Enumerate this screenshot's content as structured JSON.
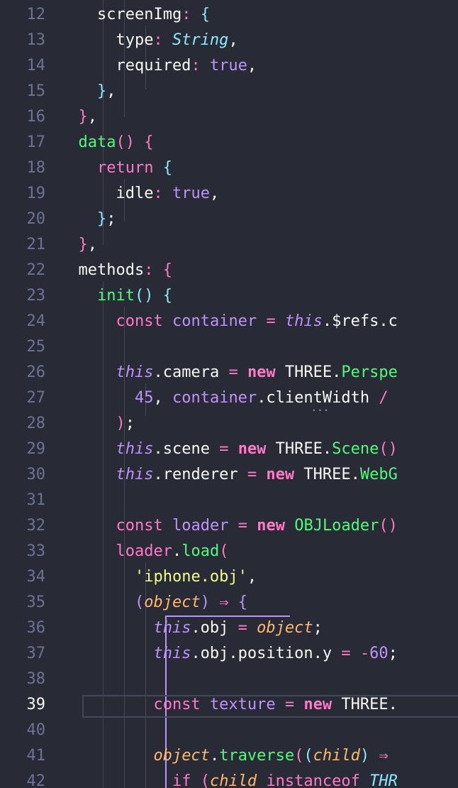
{
  "editor": {
    "theme_colors": {
      "background": "#282a36",
      "foreground": "#f8f8f2",
      "keyword": "#ff79c6",
      "function": "#50fa7b",
      "class": "#8be9fd",
      "string": "#f1fa8c",
      "number": "#bd93f9",
      "parameter": "#ffb86c",
      "gutter": "#6c7393"
    },
    "active_line": "39",
    "lines": [
      {
        "n": "12",
        "tokens": [
          [
            "t-n",
            "    screenImg"
          ],
          [
            "t-o",
            ":"
          ],
          [
            "t-n",
            " "
          ],
          [
            "t-pb",
            "{"
          ]
        ]
      },
      {
        "n": "13",
        "tokens": [
          [
            "t-n",
            "      type"
          ],
          [
            "t-o",
            ":"
          ],
          [
            "t-n",
            " "
          ],
          [
            "t-c",
            "String"
          ],
          [
            "t-n",
            ","
          ]
        ]
      },
      {
        "n": "14",
        "tokens": [
          [
            "t-n",
            "      required"
          ],
          [
            "t-o",
            ":"
          ],
          [
            "t-n",
            " "
          ],
          [
            "t-v",
            "true"
          ],
          [
            "t-n",
            ","
          ]
        ]
      },
      {
        "n": "15",
        "tokens": [
          [
            "t-n",
            "    "
          ],
          [
            "t-pb",
            "}"
          ],
          [
            "t-n",
            ","
          ]
        ]
      },
      {
        "n": "16",
        "tokens": [
          [
            "t-n",
            "  "
          ],
          [
            "t-pk",
            "}"
          ],
          [
            "t-n",
            ","
          ]
        ]
      },
      {
        "n": "17",
        "tokens": [
          [
            "t-n",
            "  "
          ],
          [
            "t-f",
            "data"
          ],
          [
            "t-pk",
            "()"
          ],
          [
            "t-n",
            " "
          ],
          [
            "t-pk",
            "{"
          ]
        ]
      },
      {
        "n": "18",
        "tokens": [
          [
            "t-n",
            "    "
          ],
          [
            "t-k",
            "return"
          ],
          [
            "t-n",
            " "
          ],
          [
            "t-pb",
            "{"
          ]
        ]
      },
      {
        "n": "19",
        "tokens": [
          [
            "t-n",
            "      idle"
          ],
          [
            "t-o",
            ":"
          ],
          [
            "t-n",
            " "
          ],
          [
            "t-v",
            "true"
          ],
          [
            "t-n",
            ","
          ]
        ]
      },
      {
        "n": "20",
        "tokens": [
          [
            "t-n",
            "    "
          ],
          [
            "t-pb",
            "}"
          ],
          [
            "t-n",
            ";"
          ]
        ]
      },
      {
        "n": "21",
        "tokens": [
          [
            "t-n",
            "  "
          ],
          [
            "t-pk",
            "}"
          ],
          [
            "t-n",
            ","
          ]
        ]
      },
      {
        "n": "22",
        "tokens": [
          [
            "t-n",
            "  methods"
          ],
          [
            "t-o",
            ":"
          ],
          [
            "t-n",
            " "
          ],
          [
            "t-pk",
            "{"
          ]
        ]
      },
      {
        "n": "23",
        "tokens": [
          [
            "t-n",
            "    "
          ],
          [
            "t-f",
            "init"
          ],
          [
            "t-pb",
            "()"
          ],
          [
            "t-n",
            " "
          ],
          [
            "t-pb",
            "{"
          ]
        ]
      },
      {
        "n": "24",
        "tokens": [
          [
            "t-n",
            "      "
          ],
          [
            "t-k",
            "const"
          ],
          [
            "t-n",
            " "
          ],
          [
            "t-v",
            "container"
          ],
          [
            "t-n",
            " "
          ],
          [
            "t-o",
            "="
          ],
          [
            "t-n",
            " "
          ],
          [
            "t-i",
            "this"
          ],
          [
            "t-n",
            ".$refs.c"
          ]
        ]
      },
      {
        "n": "25",
        "tokens": []
      },
      {
        "n": "26",
        "tokens": [
          [
            "t-n",
            "      "
          ],
          [
            "t-i",
            "this"
          ],
          [
            "t-n",
            ".camera "
          ],
          [
            "t-o",
            "="
          ],
          [
            "t-n",
            " "
          ],
          [
            "t-kb",
            "new"
          ],
          [
            "t-n",
            " THREE."
          ],
          [
            "t-f",
            "Perspe"
          ]
        ]
      },
      {
        "n": "27",
        "tokens": [
          [
            "t-n",
            "        "
          ],
          [
            "t-num",
            "45"
          ],
          [
            "t-n",
            ", "
          ],
          [
            "t-v",
            "container"
          ],
          [
            "t-n",
            ".clientWidth "
          ],
          [
            "t-o",
            "/"
          ]
        ]
      },
      {
        "n": "28",
        "tokens": [
          [
            "t-n",
            "      "
          ],
          [
            "t-pk",
            ")"
          ],
          [
            "t-n",
            ";"
          ]
        ]
      },
      {
        "n": "29",
        "tokens": [
          [
            "t-n",
            "      "
          ],
          [
            "t-i",
            "this"
          ],
          [
            "t-n",
            ".scene "
          ],
          [
            "t-o",
            "="
          ],
          [
            "t-n",
            " "
          ],
          [
            "t-kb",
            "new"
          ],
          [
            "t-n",
            " THREE."
          ],
          [
            "t-f",
            "Scene"
          ],
          [
            "t-pk",
            "()"
          ]
        ]
      },
      {
        "n": "30",
        "tokens": [
          [
            "t-n",
            "      "
          ],
          [
            "t-i",
            "this"
          ],
          [
            "t-n",
            ".renderer "
          ],
          [
            "t-o",
            "="
          ],
          [
            "t-n",
            " "
          ],
          [
            "t-kb",
            "new"
          ],
          [
            "t-n",
            " THREE."
          ],
          [
            "t-f",
            "WebG"
          ]
        ]
      },
      {
        "n": "31",
        "tokens": []
      },
      {
        "n": "32",
        "tokens": [
          [
            "t-n",
            "      "
          ],
          [
            "t-k",
            "const"
          ],
          [
            "t-n",
            " "
          ],
          [
            "t-v",
            "loader"
          ],
          [
            "t-n",
            " "
          ],
          [
            "t-o",
            "="
          ],
          [
            "t-n",
            " "
          ],
          [
            "t-kb",
            "new"
          ],
          [
            "t-n",
            " "
          ],
          [
            "t-f",
            "OBJLoader"
          ],
          [
            "t-pk",
            "()"
          ]
        ]
      },
      {
        "n": "33",
        "tokens": [
          [
            "t-n",
            "      "
          ],
          [
            "t-k",
            "loader"
          ],
          [
            "t-n",
            "."
          ],
          [
            "t-f",
            "load"
          ],
          [
            "t-pk",
            "("
          ]
        ]
      },
      {
        "n": "34",
        "tokens": [
          [
            "t-n",
            "        "
          ],
          [
            "t-s",
            "'iphone.obj'"
          ],
          [
            "t-n",
            ","
          ]
        ]
      },
      {
        "n": "35",
        "tokens": [
          [
            "t-n",
            "        "
          ],
          [
            "t-pv",
            "("
          ],
          [
            "t-p",
            "object"
          ],
          [
            "t-pv",
            ")"
          ],
          [
            "t-n",
            " "
          ],
          [
            "t-lambda",
            "⇒"
          ],
          [
            "t-n",
            " "
          ],
          [
            "t-pv",
            "{"
          ]
        ]
      },
      {
        "n": "36",
        "tokens": [
          [
            "t-n",
            "          "
          ],
          [
            "t-i",
            "this"
          ],
          [
            "t-n",
            ".obj "
          ],
          [
            "t-o",
            "="
          ],
          [
            "t-n",
            " "
          ],
          [
            "t-p",
            "object"
          ],
          [
            "t-n",
            ";"
          ]
        ]
      },
      {
        "n": "37",
        "tokens": [
          [
            "t-n",
            "          "
          ],
          [
            "t-i",
            "this"
          ],
          [
            "t-n",
            ".obj.position.y "
          ],
          [
            "t-o",
            "="
          ],
          [
            "t-n",
            " "
          ],
          [
            "t-o",
            "-"
          ],
          [
            "t-num",
            "60"
          ],
          [
            "t-n",
            ";"
          ]
        ]
      },
      {
        "n": "38",
        "tokens": []
      },
      {
        "n": "39",
        "tokens": [
          [
            "t-n",
            "          "
          ],
          [
            "t-k",
            "const"
          ],
          [
            "t-n",
            " "
          ],
          [
            "t-v",
            "texture"
          ],
          [
            "t-n",
            " "
          ],
          [
            "t-o",
            "="
          ],
          [
            "t-n",
            " "
          ],
          [
            "t-kb",
            "new"
          ],
          [
            "t-n",
            " THREE."
          ]
        ]
      },
      {
        "n": "40",
        "tokens": []
      },
      {
        "n": "41",
        "tokens": [
          [
            "t-n",
            "          "
          ],
          [
            "t-p",
            "object"
          ],
          [
            "t-n",
            "."
          ],
          [
            "t-f",
            "traverse"
          ],
          [
            "t-pk",
            "("
          ],
          [
            "t-pb",
            "("
          ],
          [
            "t-p",
            "child"
          ],
          [
            "t-pb",
            ")"
          ],
          [
            "t-n",
            " "
          ],
          [
            "t-lambda",
            "⇒"
          ]
        ]
      },
      {
        "n": "42",
        "tokens": [
          [
            "t-n",
            "            "
          ],
          [
            "t-k",
            "if"
          ],
          [
            "t-n",
            " "
          ],
          [
            "t-pk",
            "("
          ],
          [
            "t-p",
            "child"
          ],
          [
            "t-n",
            " "
          ],
          [
            "t-k",
            "instanceof"
          ],
          [
            "t-n",
            " "
          ],
          [
            "t-c",
            "THR"
          ]
        ]
      }
    ],
    "hover_hint": "..."
  }
}
